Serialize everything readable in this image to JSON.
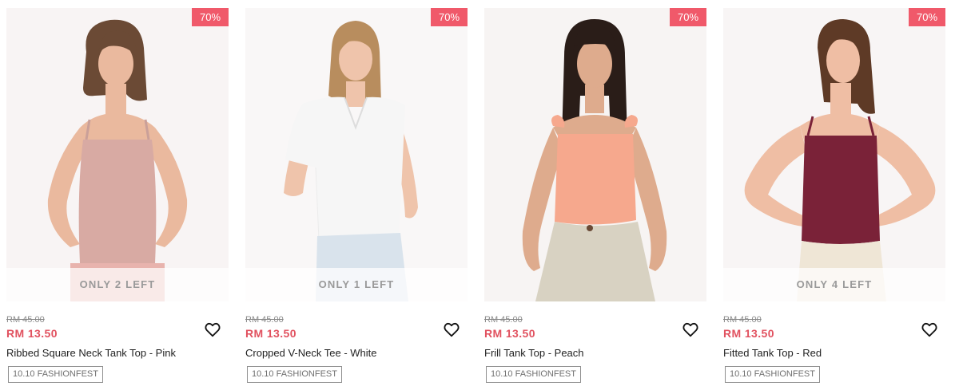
{
  "products": [
    {
      "discount": "70%",
      "stock": "ONLY 2 LEFT",
      "old_price": "RM 45.00",
      "price": "RM 13.50",
      "title": "Ribbed Square Neck Tank Top - Pink",
      "tag": "10.10 FASHIONFEST",
      "top_color": "#d8aaa3",
      "skin_color": "#eab99e",
      "hair_color": "#6b4a35"
    },
    {
      "discount": "70%",
      "stock": "ONLY 1 LEFT",
      "old_price": "RM 45.00",
      "price": "RM 13.50",
      "title": "Cropped V-Neck Tee - White",
      "tag": "10.10 FASHIONFEST",
      "top_color": "#f6f6f6",
      "skin_color": "#efc4ab",
      "hair_color": "#b88d5e"
    },
    {
      "discount": "70%",
      "stock": "",
      "old_price": "RM 45.00",
      "price": "RM 13.50",
      "title": "Frill Tank Top - Peach",
      "tag": "10.10 FASHIONFEST",
      "top_color": "#f6a88d",
      "skin_color": "#deab8d",
      "hair_color": "#2a1d18"
    },
    {
      "discount": "70%",
      "stock": "ONLY 4 LEFT",
      "old_price": "RM 45.00",
      "price": "RM 13.50",
      "title": "Fitted Tank Top - Red",
      "tag": "10.10 FASHIONFEST",
      "top_color": "#7a2238",
      "skin_color": "#efbea4",
      "hair_color": "#5e3a26"
    }
  ],
  "colors": {
    "discount_bg": "#f0596a",
    "price": "#e1515f",
    "image_bg": "#f7f4f4"
  },
  "icons": {
    "wishlist": "heart-outline-icon"
  }
}
